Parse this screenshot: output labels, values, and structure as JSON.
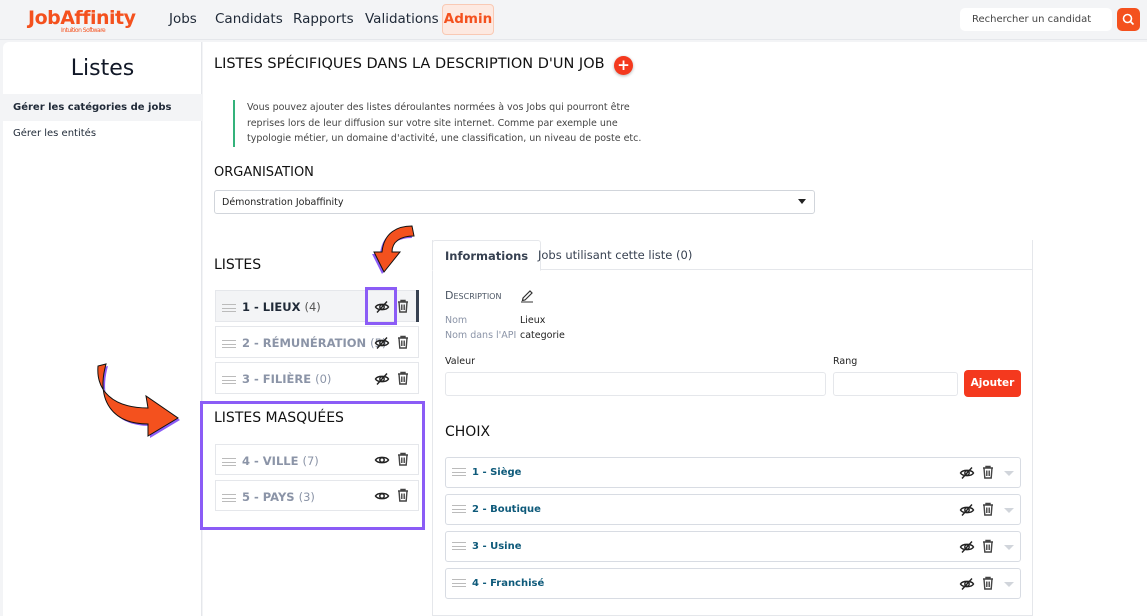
{
  "header": {
    "logo": "JobAffinity",
    "logo_tagline": "Intuition Software",
    "nav": [
      "Jobs",
      "Candidats",
      "Rapports",
      "Validations",
      "Admin"
    ],
    "search_placeholder": "Rechercher un candidat"
  },
  "sidebar": {
    "title": "Listes",
    "items": [
      "Gérer les catégories de jobs",
      "Gérer les entités"
    ]
  },
  "main": {
    "title": "LISTES SPÉCIFIQUES DANS LA DESCRIPTION D'UN JOB",
    "note": "Vous pouvez ajouter des listes déroulantes normées à vos Jobs qui pourront être reprises lors de leur diffusion sur votre site internet. Comme par exemple une typologie métier, un domaine d'activité, une classification, un niveau de poste etc.",
    "org_label": "ORGANISATION",
    "org_value": "Démonstration Jobaffinity",
    "lists_title": "LISTES",
    "lists": [
      {
        "label": "1 - LIEUX",
        "count": "(4)"
      },
      {
        "label": "2 - RÉMUNÉRATION",
        "count": "(5)"
      },
      {
        "label": "3 - FILIÈRE",
        "count": "(0)"
      }
    ],
    "hidden_title": "LISTES MASQUÉES",
    "hidden": [
      {
        "label": "4 - VILLE",
        "count": "(7)"
      },
      {
        "label": "5 - PAYS",
        "count": "(3)"
      }
    ]
  },
  "detail": {
    "tabs": [
      "Informations",
      "Jobs utilisant cette liste (0)"
    ],
    "description": "Description",
    "nom_label": "Nom",
    "nom": "Lieux",
    "api_label": "Nom dans l'API",
    "api": "categorie",
    "valeur_label": "Valeur",
    "rang_label": "Rang",
    "add": "Ajouter",
    "choix_title": "CHOIX",
    "choix": [
      "1 - Siège",
      "2 - Boutique",
      "3 - Usine",
      "4 - Franchisé"
    ]
  },
  "colors": {
    "brand": "#f4511e",
    "highlight": "#8b5cf6",
    "note_border": "#34b27b"
  }
}
